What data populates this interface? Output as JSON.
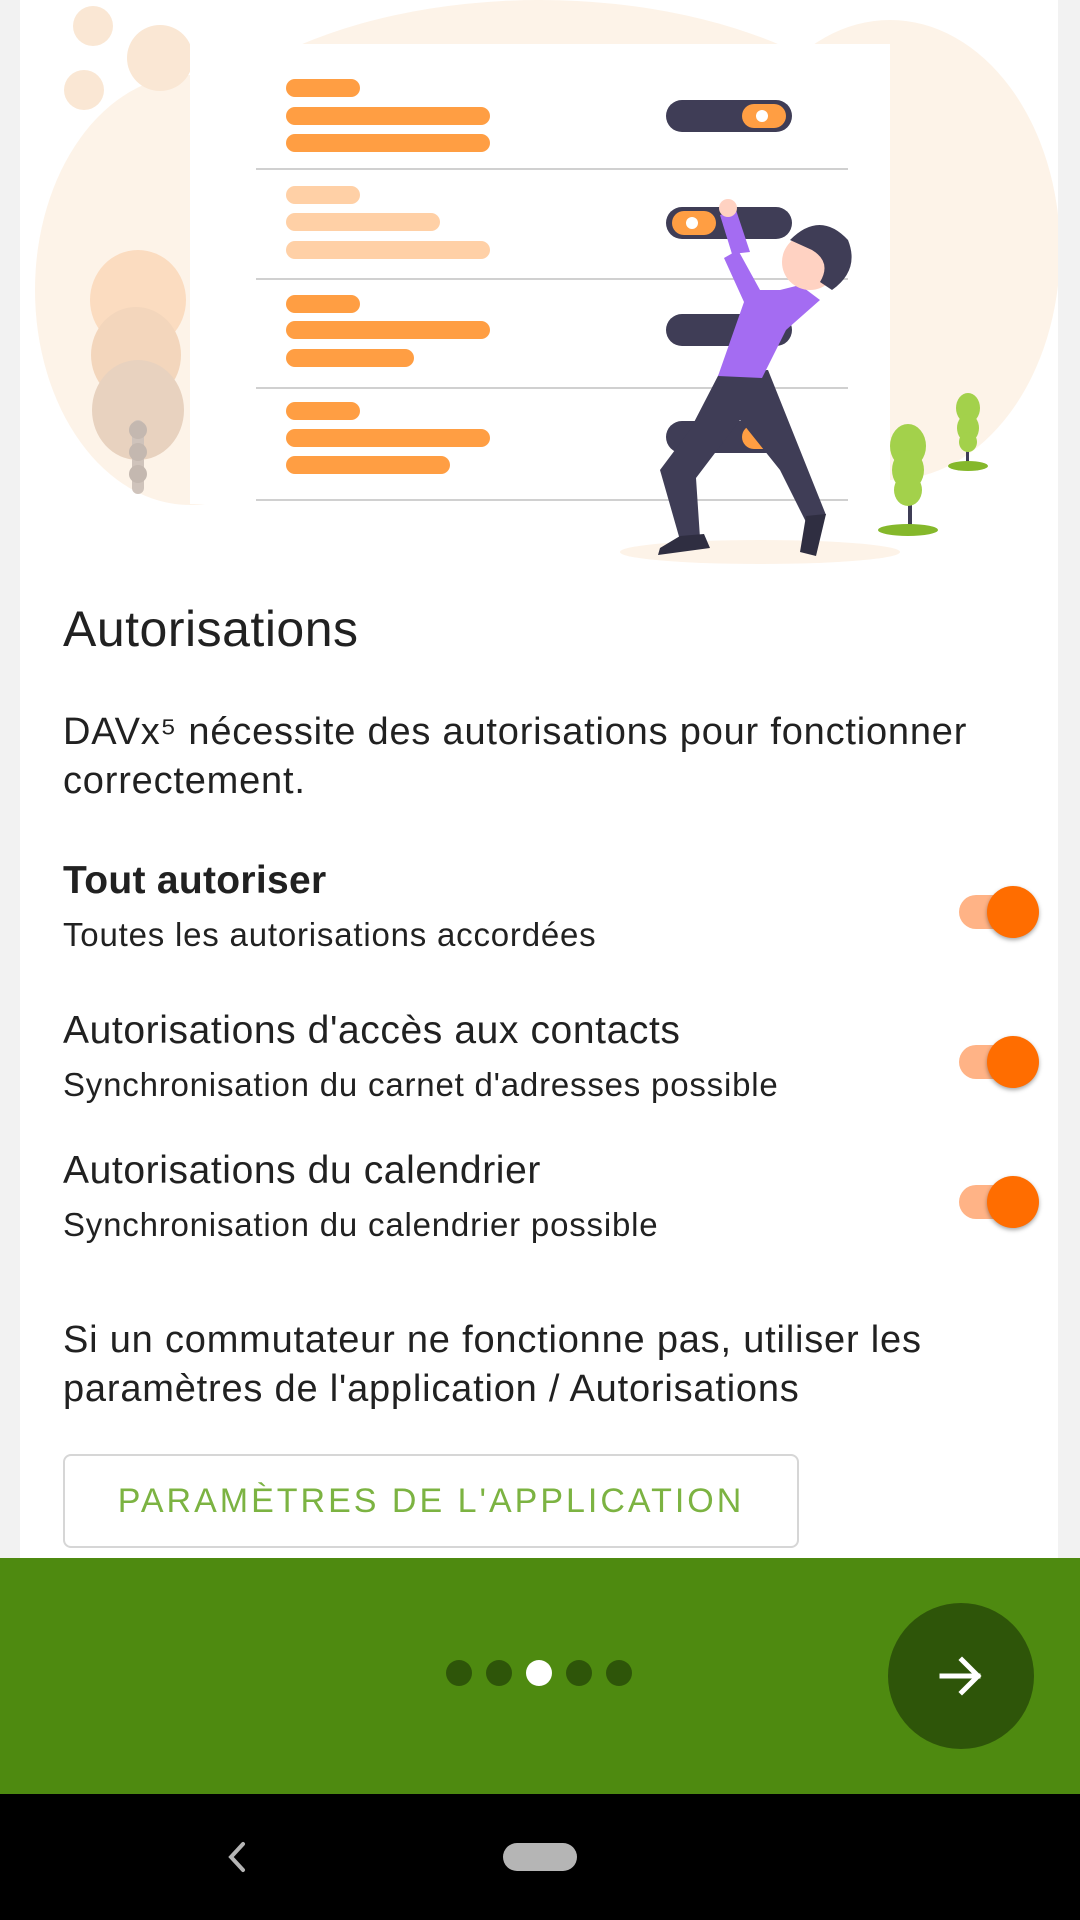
{
  "page": {
    "title": "Autorisations",
    "intro": "DAVx⁵ nécessite des autorisations pour fonctionner correctement."
  },
  "permissions": [
    {
      "title": "Tout autoriser",
      "subtitle": "Toutes les autorisations accordées",
      "enabled": true
    },
    {
      "title": "Autorisations d'accès aux contacts",
      "subtitle": "Synchronisation du carnet d'adresses possible",
      "enabled": true
    },
    {
      "title": "Autorisations du calendrier",
      "subtitle": "Synchronisation du calendrier possible",
      "enabled": true
    }
  ],
  "hint": "Si un commutateur ne fonctionne pas, utiliser les paramètres de l'application / Autorisations",
  "settings_button": {
    "label": "PARAMÈTRES DE L'APPLICATION"
  },
  "pager": {
    "total": 5,
    "current": 3
  },
  "next_button": {
    "icon": "arrow-right-icon"
  },
  "nav": {
    "back_icon": "back-icon",
    "home_icon": "home-pill-icon"
  },
  "colors": {
    "accent": "#ff6d00",
    "accent_track": "#ffb386",
    "brand_green": "#4e8a10",
    "brand_green_dark": "#2e5509",
    "button_text": "#7cb342",
    "illustration_orange": "#ff9e43",
    "illustration_purple": "#a46cf2",
    "illustration_navy": "#3f3d56"
  }
}
